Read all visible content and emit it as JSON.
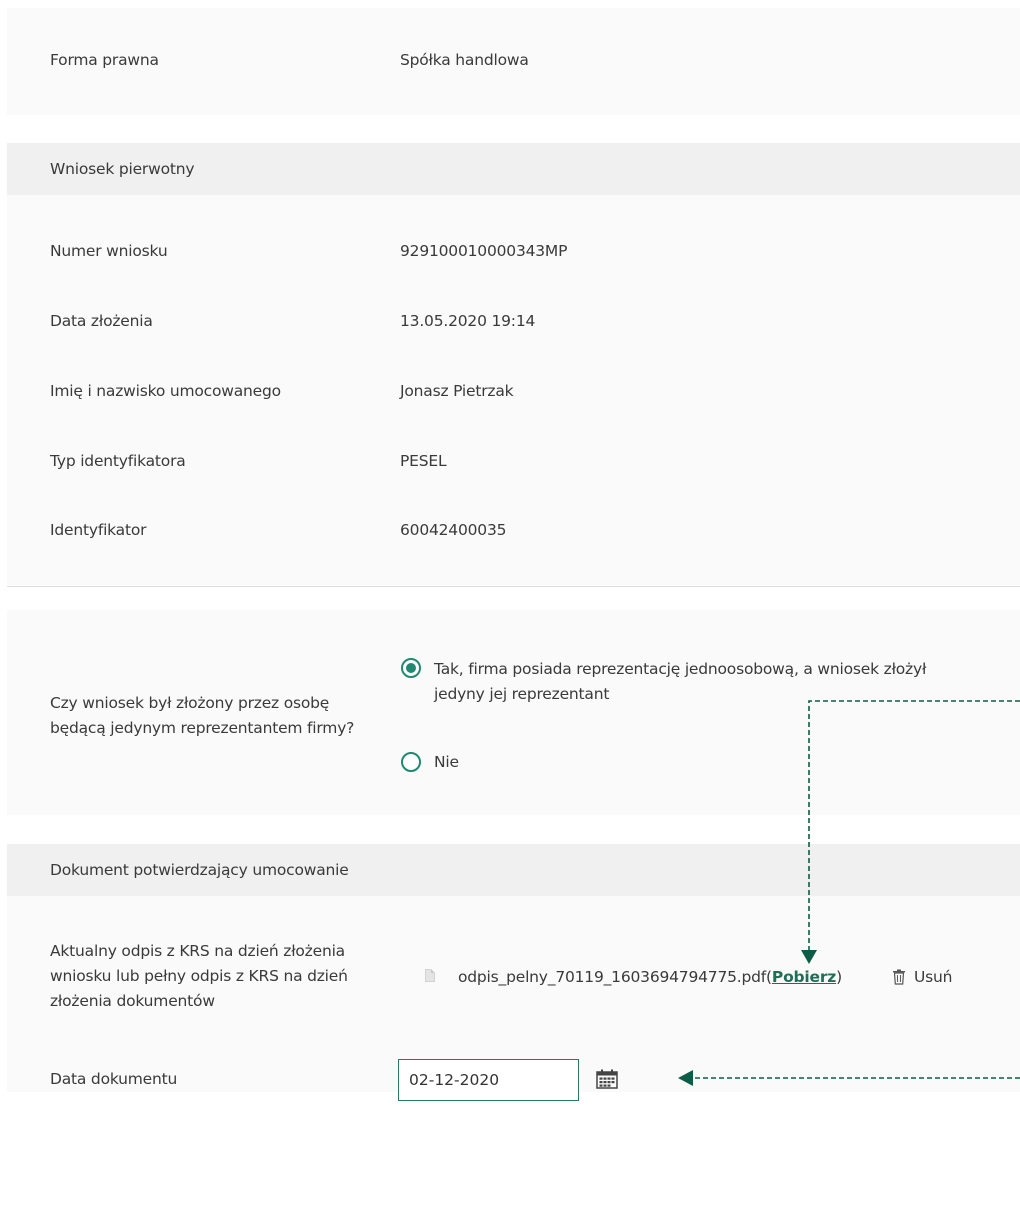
{
  "company": {
    "legal_form_label": "Forma prawna",
    "legal_form_value": "Spółka handlowa"
  },
  "original_application": {
    "section_title": "Wniosek pierwotny",
    "rows": [
      {
        "label": "Numer wniosku",
        "value": "929100010000343MP"
      },
      {
        "label": "Data złożenia",
        "value": "13.05.2020 19:14"
      },
      {
        "label": "Imię i nazwisko umocowanego",
        "value": "Jonasz Pietrzak"
      },
      {
        "label": "Typ identyfikatora",
        "value": "PESEL"
      },
      {
        "label": "Identyfikator",
        "value": "60042400035"
      }
    ]
  },
  "representation": {
    "question": "Czy wniosek był złożony przez osobę będącą jedynym reprezentantem firmy?",
    "options": [
      {
        "label": "Tak, firma posiada reprezentację jednoosobową, a wniosek złożył jedyny jej reprezentant",
        "selected": true
      },
      {
        "label": "Nie",
        "selected": false
      }
    ]
  },
  "authorization_document": {
    "section_title": "Dokument potwierdzający umocowanie",
    "krs_label": "Aktualny odpis z KRS na dzień złożenia wniosku lub pełny odpis z KRS na dzień złożenia dokumentów",
    "file": {
      "icon": "file-icon",
      "name": "odpis_pelny_70119_1603694794775.pdf",
      "open_paren": "(",
      "download_label": "Pobierz",
      "close_paren": ")",
      "remove_icon": "trash-icon",
      "remove_label": "Usuń"
    },
    "date_label": "Data dokumentu",
    "date_value": "02-12-2020",
    "calendar_icon": "calendar-icon"
  },
  "colors": {
    "accent": "#1f8a70",
    "link": "#1f6e55",
    "annotation_arrow": "#0e5c45",
    "panel_bg": "#fafafa",
    "header_bg": "#f0f0f0"
  }
}
